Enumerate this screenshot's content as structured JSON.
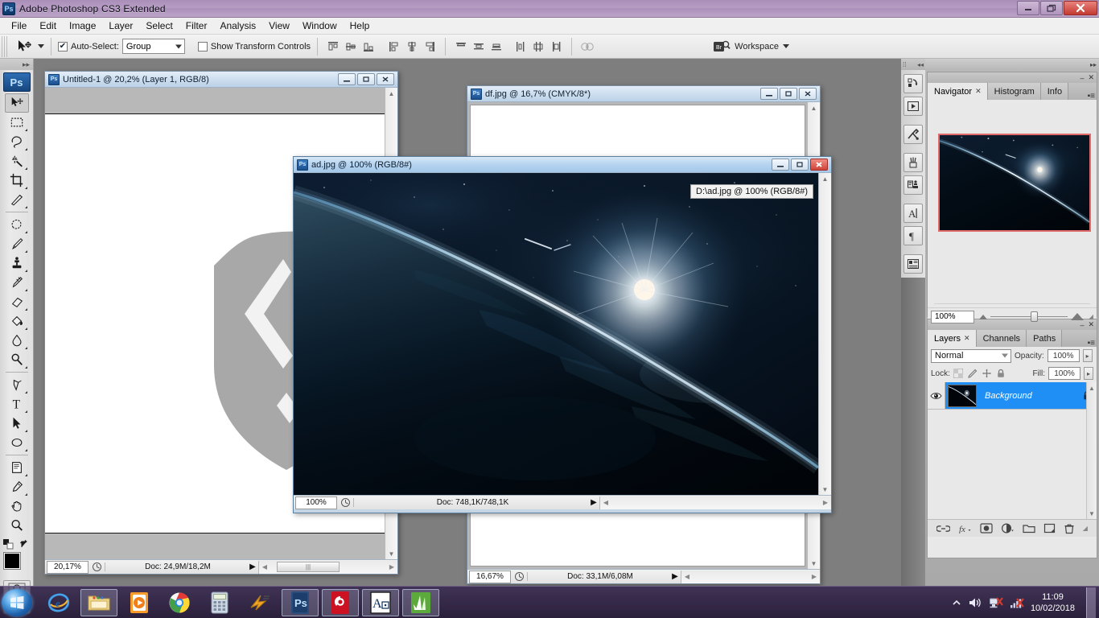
{
  "window": {
    "title": "Adobe Photoshop CS3 Extended",
    "app_icon": "photoshop-icon",
    "minimize": "–",
    "restore": "❐",
    "close": "✕"
  },
  "menubar": {
    "items": [
      "File",
      "Edit",
      "Image",
      "Layer",
      "Select",
      "Filter",
      "Analysis",
      "View",
      "Window",
      "Help"
    ]
  },
  "options_bar": {
    "active_tool": "move-tool",
    "auto_select_checked": true,
    "auto_select_label": "Auto-Select:",
    "auto_select_value": "Group",
    "show_transform_checked": false,
    "show_transform_label": "Show Transform Controls",
    "workspace_label": "Workspace",
    "bridge_label": "bridge-icon",
    "align_icons": [
      "align-top-edges-icon",
      "align-vertical-centers-icon",
      "align-bottom-edges-icon",
      "align-left-edges-icon",
      "align-horizontal-centers-icon",
      "align-right-edges-icon"
    ],
    "distribute_icons": [
      "distribute-top-edges-icon",
      "distribute-vertical-centers-icon",
      "distribute-bottom-edges-icon",
      "distribute-left-edges-icon",
      "distribute-horizontal-centers-icon",
      "distribute-right-edges-icon"
    ],
    "extra_icons": [
      "auto-align-layers-icon"
    ]
  },
  "toolbox": {
    "tools": [
      "move-tool",
      "rectangular-marquee-tool",
      "lasso-tool",
      "magic-wand-tool",
      "crop-tool",
      "slice-tool",
      "healing-brush-tool",
      "brush-tool",
      "clone-stamp-tool",
      "history-brush-tool",
      "eraser-tool",
      "paint-bucket-tool",
      "blur-tool",
      "dodge-tool",
      "pen-tool",
      "horizontal-type-tool",
      "path-selection-tool",
      "ellipse-tool",
      "notes-tool",
      "eyedropper-tool",
      "hand-tool",
      "zoom-tool"
    ],
    "swatch_foreground": "#000000",
    "swatch_background": "#ffffff",
    "quick_mask": "quick-mask-icon",
    "screen_mode": "screen-mode-icon"
  },
  "documents": [
    {
      "id": "untitled",
      "title": "Untitled-1 @ 20,2% (Layer 1, RGB/8)",
      "zoom": "20,17%",
      "doc_info": "Doc: 24,9M/18,2M",
      "active": false,
      "canvas_type": "white-shield"
    },
    {
      "id": "df",
      "title": "df.jpg @ 16,7% (CMYK/8*)",
      "zoom": "16,67%",
      "doc_info": "Doc: 33,1M/6,08M",
      "active": false,
      "canvas_type": "white"
    },
    {
      "id": "ad",
      "title": "ad.jpg @ 100% (RGB/8#)",
      "zoom": "100%",
      "doc_info": "Doc: 748,1K/748,1K",
      "active": true,
      "canvas_type": "space",
      "tooltip": "D:\\ad.jpg @ 100% (RGB/8#)"
    }
  ],
  "dock_rail": {
    "icons": [
      "history-actions-icon",
      "actions-play-icon",
      "tool-presets-icon",
      "brushes-icon",
      "clone-source-icon",
      "character-icon",
      "paragraph-icon",
      "layer-comps-icon"
    ]
  },
  "navigator_panel": {
    "tabs": [
      {
        "label": "Navigator",
        "active": true,
        "closable": true
      },
      {
        "label": "Histogram",
        "active": false,
        "closable": false
      },
      {
        "label": "Info",
        "active": false,
        "closable": false
      }
    ],
    "zoom_value": "100%",
    "minimize": "–",
    "close": "✕",
    "view_box_color": "#e06a6a",
    "zoom_out_icon": "zoom-out-icon",
    "zoom_in_icon": "zoom-in-icon"
  },
  "layers_panel": {
    "tabs": [
      {
        "label": "Layers",
        "active": true,
        "closable": true
      },
      {
        "label": "Channels",
        "active": false,
        "closable": false
      },
      {
        "label": "Paths",
        "active": false,
        "closable": false
      }
    ],
    "blend_mode": "Normal",
    "opacity_label": "Opacity:",
    "opacity_value": "100%",
    "lock_label": "Lock:",
    "lock_icons": [
      "lock-transparency-icon",
      "lock-image-icon",
      "lock-position-icon",
      "lock-all-icon"
    ],
    "fill_label": "Fill:",
    "fill_value": "100%",
    "layers": [
      {
        "name": "Background",
        "visible": true,
        "locked": true,
        "selected": true
      }
    ],
    "footer_icons": [
      "link-layers-icon",
      "layer-style-icon",
      "layer-mask-icon",
      "adjustment-layer-icon",
      "new-group-icon",
      "new-layer-icon",
      "delete-layer-icon"
    ],
    "selection_color": "#1f8ff5"
  },
  "taskbar": {
    "start": "start-orb-icon",
    "items": [
      {
        "name": "internet-explorer-icon",
        "pinned": false
      },
      {
        "name": "windows-explorer-icon",
        "pinned": true
      },
      {
        "name": "media-player-icon",
        "pinned": false
      },
      {
        "name": "google-chrome-icon",
        "pinned": false
      },
      {
        "name": "calculator-icon",
        "pinned": false
      },
      {
        "name": "winamp-icon",
        "pinned": false
      },
      {
        "name": "photoshop-icon",
        "pinned": true
      },
      {
        "name": "red-app-icon",
        "pinned": true
      },
      {
        "name": "autocad-icon",
        "pinned": true
      },
      {
        "name": "green-leaf-app-icon",
        "pinned": true
      }
    ],
    "tray": {
      "show_hidden": "chevron-up-icon",
      "volume": "speaker-icon",
      "network_error": "network-disconnected-icon",
      "signal_error": "signal-no-connection-icon"
    },
    "time": "11:09",
    "date": "10/02/2018"
  }
}
